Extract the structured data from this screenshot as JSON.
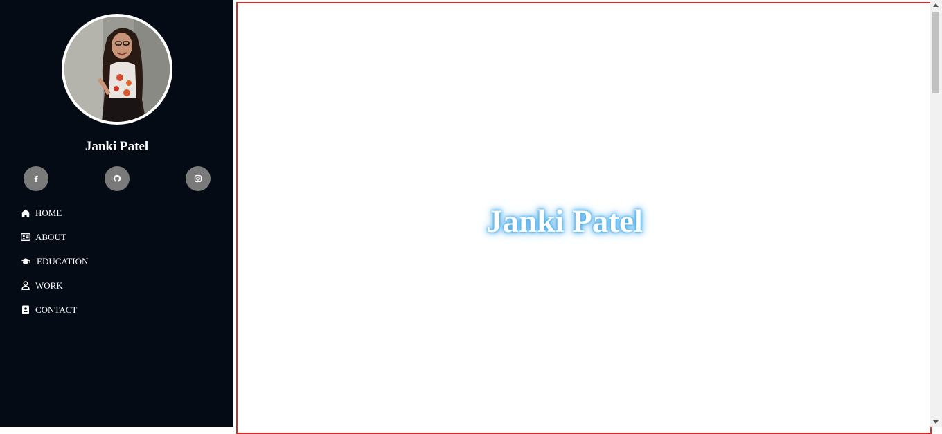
{
  "profile": {
    "name": "Janki Patel",
    "avatar_icon": "profile-photo"
  },
  "social": [
    {
      "icon": "facebook-icon"
    },
    {
      "icon": "github-icon"
    },
    {
      "icon": "instagram-icon"
    }
  ],
  "nav": {
    "items": [
      {
        "label": "HOME",
        "icon": "home-icon"
      },
      {
        "label": "ABOUT",
        "icon": "id-card-icon"
      },
      {
        "label": "EDUCATION",
        "icon": "graduation-cap-icon"
      },
      {
        "label": "WORK",
        "icon": "user-icon"
      },
      {
        "label": "CONTACT",
        "icon": "address-book-icon"
      }
    ]
  },
  "hero": {
    "title": "Janki Patel"
  },
  "colors": {
    "sidebar_bg": "#040b14",
    "social_bg": "#7a7a7a",
    "main_border": "#d42b2b",
    "title_glow": "#2d9ce6"
  }
}
